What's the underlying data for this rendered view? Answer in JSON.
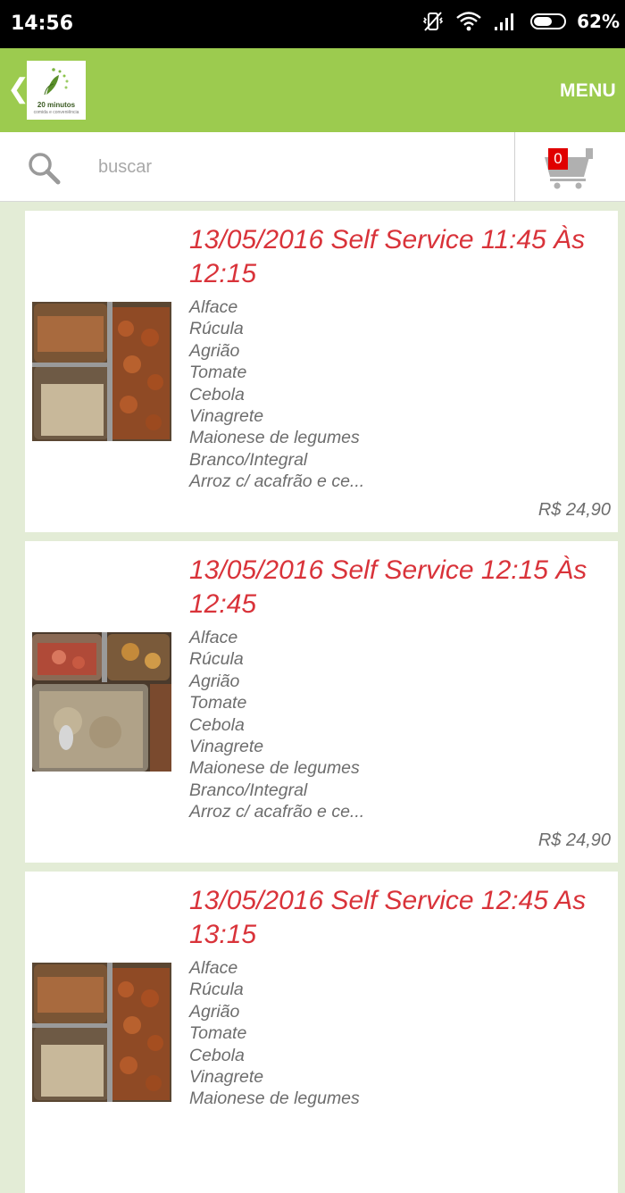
{
  "status_bar": {
    "time": "14:56",
    "battery_percent": "62%",
    "battery_level": 0.62
  },
  "header": {
    "logo_text": "20 minutos",
    "logo_subtext": "comida e conveniência",
    "menu_label": "MENU"
  },
  "search": {
    "placeholder": "buscar"
  },
  "cart": {
    "count": "0"
  },
  "products": [
    {
      "title": "13/05/2016 Self Service 11:45 Às 12:15",
      "items": [
        "Alface",
        "Rúcula",
        "Agrião",
        "Tomate",
        "Cebola",
        "Vinagrete",
        "Maionese de legumes",
        "Branco/Integral",
        "Arroz c/ acafrão e ce..."
      ],
      "price": "R$ 24,90"
    },
    {
      "title": "13/05/2016 Self Service 12:15 Às 12:45",
      "items": [
        "Alface",
        "Rúcula",
        "Agrião",
        "Tomate",
        "Cebola",
        "Vinagrete",
        "Maionese de legumes",
        "Branco/Integral",
        "Arroz c/ acafrão e ce..."
      ],
      "price": "R$ 24,90"
    },
    {
      "title": "13/05/2016 Self Service 12:45 As 13:15",
      "items": [
        "Alface",
        "Rúcula",
        "Agrião",
        "Tomate",
        "Cebola",
        "Vinagrete",
        "Maionese de legumes"
      ],
      "price": ""
    }
  ],
  "colors": {
    "app_bar": "#9ccb4f",
    "title_red": "#d9333a",
    "badge_red": "#e00000",
    "background": "#e3ecd6"
  }
}
